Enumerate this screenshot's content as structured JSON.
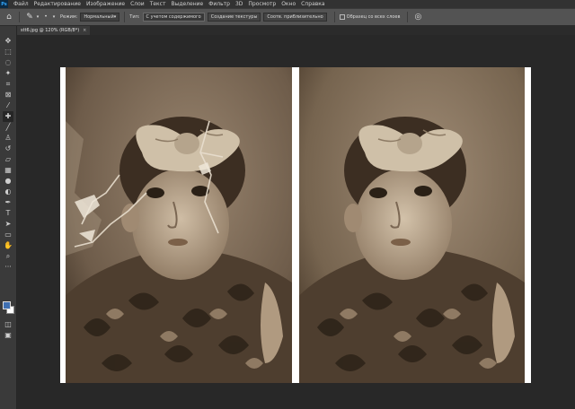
{
  "menubar": {
    "logo": "Ps",
    "items": [
      "Файл",
      "Редактирование",
      "Изображение",
      "Слои",
      "Текст",
      "Выделение",
      "Фильтр",
      "3D",
      "Просмотр",
      "Окно",
      "Справка"
    ]
  },
  "options": {
    "mode_label": "Режим:",
    "mode_value": "Нормальный",
    "type_label": "Тип:",
    "buttons": [
      "С учетом содержимого",
      "Создание текстуры",
      "Соотв. приблизительно"
    ],
    "sample_all_label": "Образец со всех слоев"
  },
  "document_tab": {
    "title": "stt6.jpg @ 120% (RGB/8*)",
    "close": "×"
  },
  "tools": [
    "move-icon",
    "marquee-icon",
    "lasso-icon",
    "quick-select-icon",
    "crop-icon",
    "frame-icon",
    "eyedropper-icon",
    "spot-healing-icon",
    "brush-icon",
    "clone-stamp-icon",
    "history-brush-icon",
    "eraser-icon",
    "gradient-icon",
    "blur-icon",
    "dodge-icon",
    "pen-icon",
    "type-icon",
    "path-select-icon",
    "shape-icon",
    "hand-icon",
    "zoom-icon",
    "more-tools-icon"
  ],
  "colors": {
    "foreground": "#3f6fb1",
    "background": "#ffffff",
    "sepia_dark": "#3a2c20",
    "sepia_mid": "#8b7560",
    "sepia_light": "#bfae98"
  }
}
